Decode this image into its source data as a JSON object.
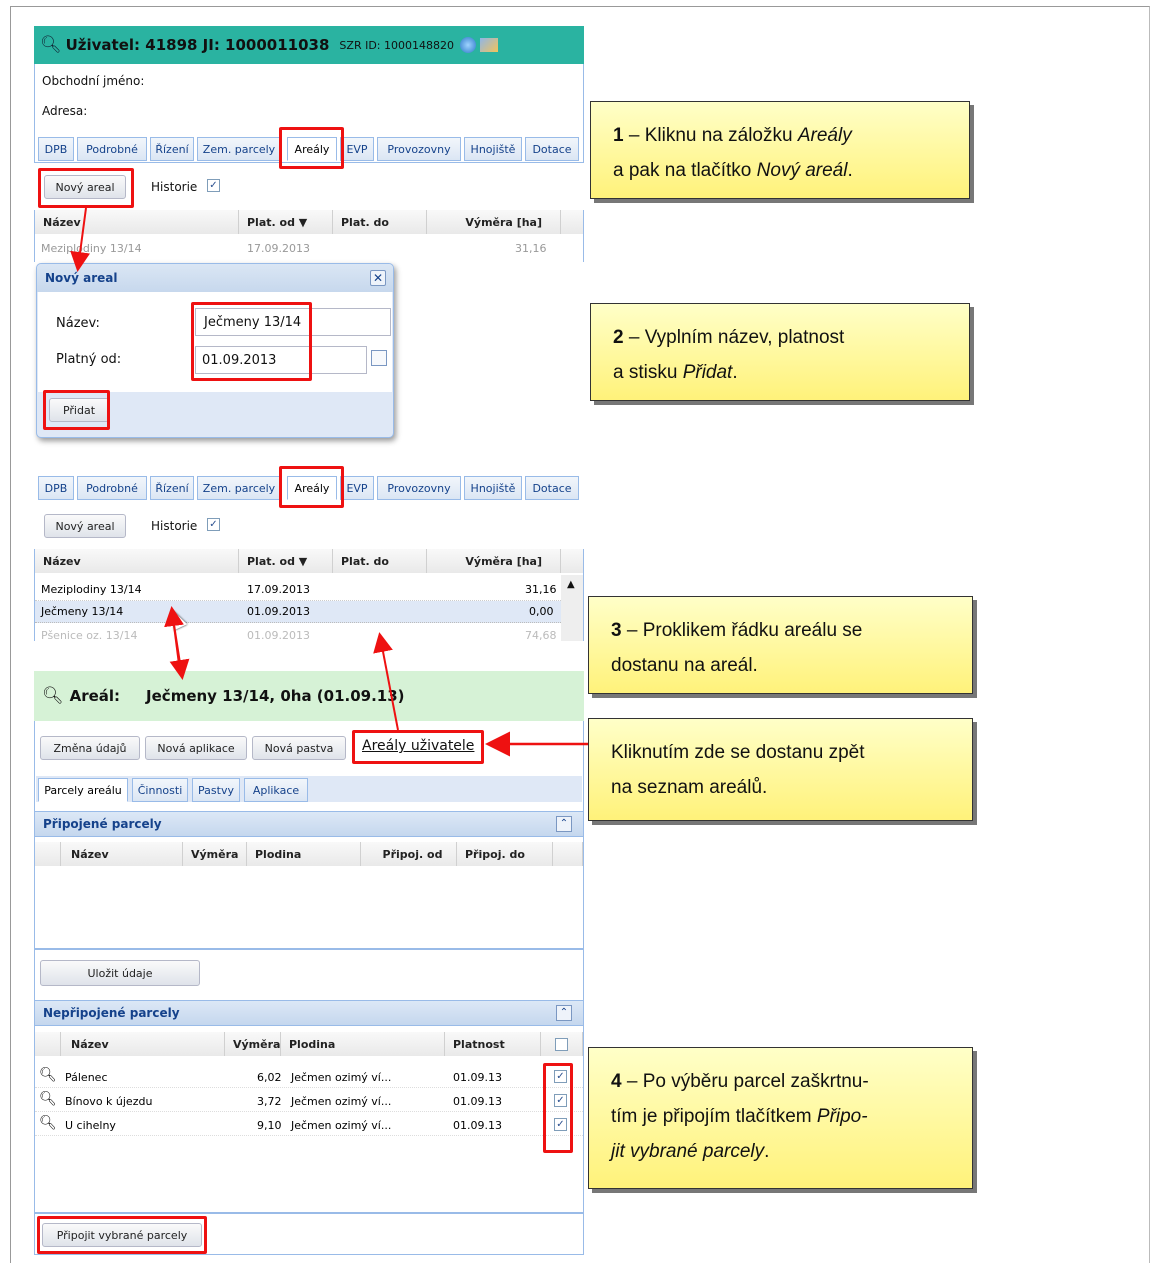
{
  "header": {
    "title": "Uživatel: 41898 JI: 1000011038",
    "szr": "SZR ID: 1000148820",
    "obchodni_label": "Obchodní jméno:",
    "adresa_label": "Adresa:",
    "accent": "#2ab3a1"
  },
  "tabs": [
    "DPB",
    "Podrobné",
    "Řízení",
    "Zem. parcely",
    "Areály",
    "EVP",
    "Provozovny",
    "Hnojiště",
    "Dotace"
  ],
  "areal_list": {
    "new_button": "Nový areal",
    "history_label": "Historie",
    "columns": [
      "Název",
      "Plat. od ▼",
      "Plat. do",
      "Výměra [ha]"
    ],
    "rows_top": [
      {
        "name": "Meziplodiny 13/14",
        "od": "17.09.2013",
        "vymera": "31,16"
      }
    ],
    "rows": [
      {
        "name": "Meziplodiny 13/14",
        "od": "17.09.2013",
        "vymera": "31,16"
      },
      {
        "name": "Ječmeny 13/14",
        "od": "01.09.2013",
        "vymera": "0,00"
      },
      {
        "name": "Pšenice oz. 13/14",
        "od": "01.09.2013",
        "vymera": "74,68"
      }
    ]
  },
  "dialog": {
    "title": "Nový areal",
    "name_label": "Název:",
    "name_value": "Ječmeny 13/14",
    "date_label": "Platný od:",
    "date_value": "01.09.2013",
    "add_button": "Přidat"
  },
  "areal_detail": {
    "title_label": "Areál:",
    "title_value": "Ječmeny 13/14, 0ha (01.09.13)",
    "buttons": [
      "Změna údajů",
      "Nová aplikace",
      "Nová pastva"
    ],
    "link": "Areály uživatele",
    "subtabs": [
      "Parcely areálu",
      "Činnosti",
      "Pastvy",
      "Aplikace"
    ],
    "connected": {
      "title": "Připojené parcely",
      "columns": [
        "Název",
        "Výměra",
        "Plodina",
        "Připoj. od",
        "Připoj. do"
      ],
      "save_button": "Uložit údaje"
    },
    "unconnected": {
      "title": "Nepřipojené parcely",
      "columns": [
        "Název",
        "Výměra",
        "Plodina",
        "Platnost"
      ],
      "rows": [
        {
          "name": "Pálenec",
          "vymera": "6,02",
          "plodina": "Ječmen ozimý ví...",
          "platnost": "01.09.13"
        },
        {
          "name": "Bínovo k újezdu",
          "vymera": "3,72",
          "plodina": "Ječmen ozimý ví...",
          "platnost": "01.09.13"
        },
        {
          "name": "U cihelny",
          "vymera": "9,10",
          "plodina": "Ječmen ozimý ví...",
          "platnost": "01.09.13"
        }
      ],
      "connect_button": "Připojit vybrané parcely"
    }
  },
  "callouts": {
    "c1": {
      "num": "1",
      "l1": " – Kliknu na záložku ",
      "l1i": "Areály",
      "l2": "a pak na tlačítko ",
      "l2i": "Nový areál",
      "l2e": "."
    },
    "c2": {
      "num": "2",
      "l1": " – Vyplním název, platnost",
      "l2": "a stisku ",
      "l2i": "Přidat",
      "l2e": "."
    },
    "c3": {
      "num": "3",
      "l1": " – Proklikem řádku areálu se",
      "l2": "dostanu na areál."
    },
    "c4": {
      "l1": "Kliknutím zde se dostanu zpět",
      "l2": "na seznam areálů."
    },
    "c5": {
      "num": "4",
      "l1": " – Po výběru parcel zaškrtnu-",
      "l2": "tím je připojím tlačítkem ",
      "l2i": "Připo-",
      "l3i": "jit vybrané parcely",
      "l3e": "."
    }
  }
}
